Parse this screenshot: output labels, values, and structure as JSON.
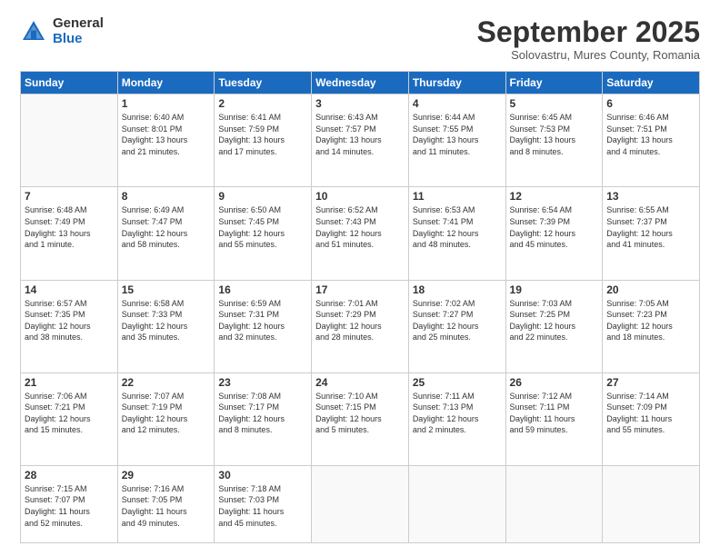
{
  "logo": {
    "general": "General",
    "blue": "Blue"
  },
  "header": {
    "month": "September 2025",
    "location": "Solovastru, Mures County, Romania"
  },
  "weekdays": [
    "Sunday",
    "Monday",
    "Tuesday",
    "Wednesday",
    "Thursday",
    "Friday",
    "Saturday"
  ],
  "weeks": [
    [
      {
        "day": "",
        "info": ""
      },
      {
        "day": "1",
        "info": "Sunrise: 6:40 AM\nSunset: 8:01 PM\nDaylight: 13 hours\nand 21 minutes."
      },
      {
        "day": "2",
        "info": "Sunrise: 6:41 AM\nSunset: 7:59 PM\nDaylight: 13 hours\nand 17 minutes."
      },
      {
        "day": "3",
        "info": "Sunrise: 6:43 AM\nSunset: 7:57 PM\nDaylight: 13 hours\nand 14 minutes."
      },
      {
        "day": "4",
        "info": "Sunrise: 6:44 AM\nSunset: 7:55 PM\nDaylight: 13 hours\nand 11 minutes."
      },
      {
        "day": "5",
        "info": "Sunrise: 6:45 AM\nSunset: 7:53 PM\nDaylight: 13 hours\nand 8 minutes."
      },
      {
        "day": "6",
        "info": "Sunrise: 6:46 AM\nSunset: 7:51 PM\nDaylight: 13 hours\nand 4 minutes."
      }
    ],
    [
      {
        "day": "7",
        "info": "Sunrise: 6:48 AM\nSunset: 7:49 PM\nDaylight: 13 hours\nand 1 minute."
      },
      {
        "day": "8",
        "info": "Sunrise: 6:49 AM\nSunset: 7:47 PM\nDaylight: 12 hours\nand 58 minutes."
      },
      {
        "day": "9",
        "info": "Sunrise: 6:50 AM\nSunset: 7:45 PM\nDaylight: 12 hours\nand 55 minutes."
      },
      {
        "day": "10",
        "info": "Sunrise: 6:52 AM\nSunset: 7:43 PM\nDaylight: 12 hours\nand 51 minutes."
      },
      {
        "day": "11",
        "info": "Sunrise: 6:53 AM\nSunset: 7:41 PM\nDaylight: 12 hours\nand 48 minutes."
      },
      {
        "day": "12",
        "info": "Sunrise: 6:54 AM\nSunset: 7:39 PM\nDaylight: 12 hours\nand 45 minutes."
      },
      {
        "day": "13",
        "info": "Sunrise: 6:55 AM\nSunset: 7:37 PM\nDaylight: 12 hours\nand 41 minutes."
      }
    ],
    [
      {
        "day": "14",
        "info": "Sunrise: 6:57 AM\nSunset: 7:35 PM\nDaylight: 12 hours\nand 38 minutes."
      },
      {
        "day": "15",
        "info": "Sunrise: 6:58 AM\nSunset: 7:33 PM\nDaylight: 12 hours\nand 35 minutes."
      },
      {
        "day": "16",
        "info": "Sunrise: 6:59 AM\nSunset: 7:31 PM\nDaylight: 12 hours\nand 32 minutes."
      },
      {
        "day": "17",
        "info": "Sunrise: 7:01 AM\nSunset: 7:29 PM\nDaylight: 12 hours\nand 28 minutes."
      },
      {
        "day": "18",
        "info": "Sunrise: 7:02 AM\nSunset: 7:27 PM\nDaylight: 12 hours\nand 25 minutes."
      },
      {
        "day": "19",
        "info": "Sunrise: 7:03 AM\nSunset: 7:25 PM\nDaylight: 12 hours\nand 22 minutes."
      },
      {
        "day": "20",
        "info": "Sunrise: 7:05 AM\nSunset: 7:23 PM\nDaylight: 12 hours\nand 18 minutes."
      }
    ],
    [
      {
        "day": "21",
        "info": "Sunrise: 7:06 AM\nSunset: 7:21 PM\nDaylight: 12 hours\nand 15 minutes."
      },
      {
        "day": "22",
        "info": "Sunrise: 7:07 AM\nSunset: 7:19 PM\nDaylight: 12 hours\nand 12 minutes."
      },
      {
        "day": "23",
        "info": "Sunrise: 7:08 AM\nSunset: 7:17 PM\nDaylight: 12 hours\nand 8 minutes."
      },
      {
        "day": "24",
        "info": "Sunrise: 7:10 AM\nSunset: 7:15 PM\nDaylight: 12 hours\nand 5 minutes."
      },
      {
        "day": "25",
        "info": "Sunrise: 7:11 AM\nSunset: 7:13 PM\nDaylight: 12 hours\nand 2 minutes."
      },
      {
        "day": "26",
        "info": "Sunrise: 7:12 AM\nSunset: 7:11 PM\nDaylight: 11 hours\nand 59 minutes."
      },
      {
        "day": "27",
        "info": "Sunrise: 7:14 AM\nSunset: 7:09 PM\nDaylight: 11 hours\nand 55 minutes."
      }
    ],
    [
      {
        "day": "28",
        "info": "Sunrise: 7:15 AM\nSunset: 7:07 PM\nDaylight: 11 hours\nand 52 minutes."
      },
      {
        "day": "29",
        "info": "Sunrise: 7:16 AM\nSunset: 7:05 PM\nDaylight: 11 hours\nand 49 minutes."
      },
      {
        "day": "30",
        "info": "Sunrise: 7:18 AM\nSunset: 7:03 PM\nDaylight: 11 hours\nand 45 minutes."
      },
      {
        "day": "",
        "info": ""
      },
      {
        "day": "",
        "info": ""
      },
      {
        "day": "",
        "info": ""
      },
      {
        "day": "",
        "info": ""
      }
    ]
  ]
}
